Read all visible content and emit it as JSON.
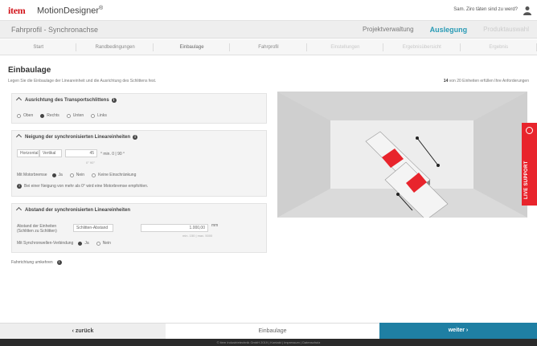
{
  "brand": {
    "logo": "item",
    "app_name": "MotionDesigner",
    "mark": "®"
  },
  "topbar": {
    "user_text": "Sam. Ziro täten sind zu werd?"
  },
  "project": {
    "title": "Fahrprofil - Synchronachse"
  },
  "project_nav": [
    {
      "label": "Projektverwaltung",
      "state": "normal"
    },
    {
      "label": "Auslegung",
      "state": "active"
    },
    {
      "label": "Produktauswahl",
      "state": "disabled"
    }
  ],
  "steps": [
    {
      "label": "Start",
      "state": "done"
    },
    {
      "label": "Randbedingungen",
      "state": "done"
    },
    {
      "label": "Einbaulage",
      "state": "active"
    },
    {
      "label": "Fahrprofil",
      "state": "done"
    },
    {
      "label": "Einstellungen",
      "state": "future"
    },
    {
      "label": "Ergebnisübersicht",
      "state": "future"
    },
    {
      "label": "Ergebnis",
      "state": "future"
    }
  ],
  "page": {
    "title": "Einbaulage",
    "intro": "Legen Sie die Einbaulage der Lineareinheit und die Ausrichtung des Schlittens fest.",
    "count_a": "14",
    "count_b": "von 20 Einheiten erfüllen Ihre Anforderungen"
  },
  "section1": {
    "title": "Ausrichtung des Transportschlittens",
    "options": [
      {
        "label": "Oben",
        "checked": false
      },
      {
        "label": "Rechts",
        "checked": true
      },
      {
        "label": "Unten",
        "checked": false
      },
      {
        "label": "Links",
        "checked": false
      }
    ]
  },
  "section2": {
    "title": "Neigung der synchronisierten Lineareinheiten",
    "orientation_label": "Horizontal",
    "orientation_value": "Vertikal",
    "angle_value": "45",
    "angle_unit": "° min. 0 | 90 °",
    "hint": "0°        90°",
    "motor_label": "Mit Motorbremse",
    "motor_options": [
      {
        "label": "Ja",
        "checked": true
      },
      {
        "label": "Nein",
        "checked": false
      },
      {
        "label": "Keine Einschränkung",
        "checked": false
      }
    ],
    "info_text": "Bei einer Neigung von mehr als 0° wird eine Motorbremse empfohlen."
  },
  "section3": {
    "title": "Abstand der synchronisierten Lineareinheiten",
    "distance_label_1": "Abstand der Einheiten",
    "distance_label_2": "(Schlitten zu Schlitten)",
    "distance_select": "Schlitten-Abstand",
    "distance_value": "1.000,00",
    "distance_unit": "mm",
    "distance_hint": "min. 150 | max. 5000",
    "sync_label": "Mit Synchronwellen-Verbindung",
    "sync_options": [
      {
        "label": "Ja",
        "checked": true
      },
      {
        "label": "Nein",
        "checked": false
      }
    ]
  },
  "footnote": "Fahrrichtung umkehren",
  "support_label": "LIVE SUPPORT",
  "bottom": {
    "back": "‹ zurück",
    "crumb": "Einbaulage",
    "next": "weiter ›"
  },
  "copyright": "© item Industrietechnik GmbH 2019 | Kontakt | Impressum | Datenschutz",
  "colors": {
    "brand_red": "#d2161c",
    "accent_teal": "#2a9bb5",
    "primary_button": "#1f7fa3",
    "support_red": "#e8242c"
  }
}
